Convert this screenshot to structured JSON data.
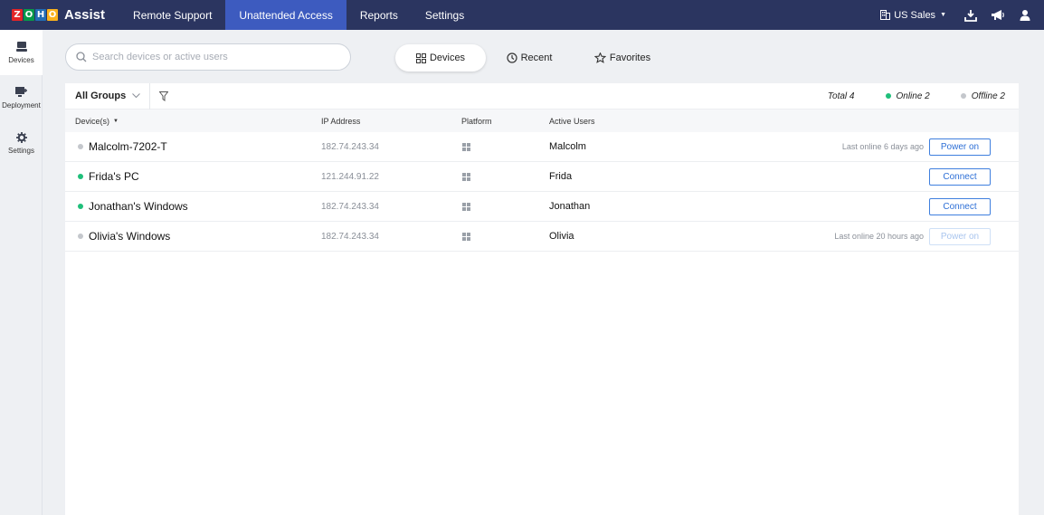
{
  "logo": {
    "letters": [
      {
        "ch": "Z",
        "color": "#e42527"
      },
      {
        "ch": "O",
        "color": "#089949"
      },
      {
        "ch": "H",
        "color": "#226db4"
      },
      {
        "ch": "O",
        "color": "#f9b21d"
      }
    ],
    "app_name": "Assist"
  },
  "nav": {
    "items": [
      {
        "label": "Remote Support",
        "active": false
      },
      {
        "label": "Unattended Access",
        "active": true
      },
      {
        "label": "Reports",
        "active": false
      },
      {
        "label": "Settings",
        "active": false
      }
    ]
  },
  "top_right": {
    "org_label": "US Sales",
    "icons": [
      "download-icon",
      "announcement-icon",
      "user-icon"
    ]
  },
  "rail": {
    "items": [
      {
        "label": "Devices",
        "icon": "devices-icon",
        "active": true
      },
      {
        "label": "Deployment",
        "icon": "deployment-icon",
        "active": false
      },
      {
        "label": "Settings",
        "icon": "gear-icon",
        "active": false
      }
    ]
  },
  "search": {
    "placeholder": "Search devices or active users",
    "value": ""
  },
  "tabs": [
    {
      "label": "Devices",
      "icon": "grid-icon",
      "active": true
    },
    {
      "label": "Recent",
      "icon": "clock-icon",
      "active": false
    },
    {
      "label": "Favorites",
      "icon": "star-icon",
      "active": false
    }
  ],
  "toolbar": {
    "group_label": "All Groups",
    "total": "Total 4",
    "online": "Online 2",
    "offline": "Offline 2"
  },
  "table": {
    "columns": [
      "Device(s)",
      "IP Address",
      "Platform",
      "Active Users"
    ],
    "rows": [
      {
        "name": "Malcolm-7202-T",
        "online": false,
        "ip": "182.74.243.34",
        "platform": "windows-icon",
        "user": "Malcolm",
        "last_online": "Last online 6 days ago",
        "action": "Power on",
        "action_enabled": true
      },
      {
        "name": "Frida's PC",
        "online": true,
        "ip": "121.244.91.22",
        "platform": "windows-icon",
        "user": "Frida",
        "last_online": "",
        "action": "Connect",
        "action_enabled": true
      },
      {
        "name": "Jonathan's Windows",
        "online": true,
        "ip": "182.74.243.34",
        "platform": "windows-icon",
        "user": "Jonathan",
        "last_online": "",
        "action": "Connect",
        "action_enabled": true
      },
      {
        "name": "Olivia's Windows",
        "online": false,
        "ip": "182.74.243.34",
        "platform": "windows-icon",
        "user": "Olivia",
        "last_online": "Last online 20 hours ago",
        "action": "Power on",
        "action_enabled": false
      }
    ]
  },
  "colors": {
    "topbar": "#2b3560",
    "nav_active": "#3d5bbf",
    "online": "#1fbf7a",
    "offline": "#c4c7cc",
    "button": "#2d6fd6"
  }
}
